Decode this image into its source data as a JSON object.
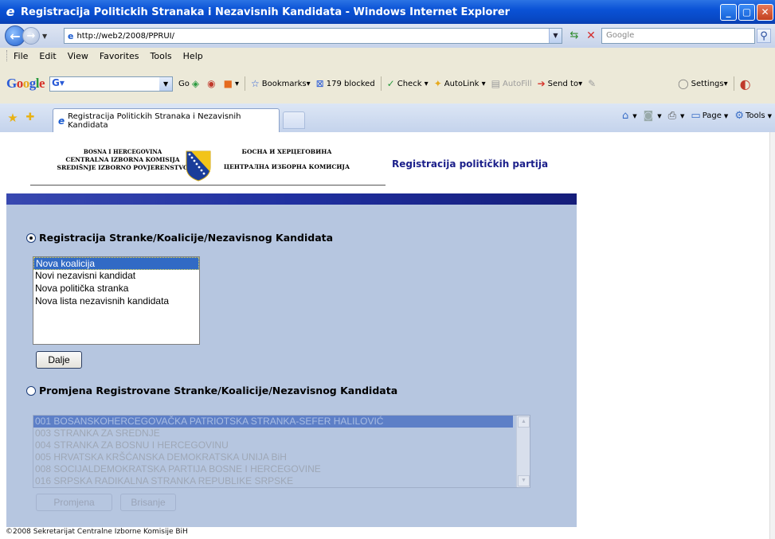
{
  "window": {
    "title": "Registracija Politickih Stranaka i Nezavisnih Kandidata - Windows Internet Explorer",
    "btn_min": "_",
    "btn_max": "▢",
    "btn_close": "✕"
  },
  "address": {
    "url": "http://web2/2008/PPRUI/",
    "search_placeholder": "Google"
  },
  "menu": [
    "File",
    "Edit",
    "View",
    "Favorites",
    "Tools",
    "Help"
  ],
  "google_toolbar": {
    "logo_letters": [
      "G",
      "o",
      "o",
      "g",
      "l",
      "e"
    ],
    "go_label": "Go",
    "bookmarks_label": "Bookmarks",
    "blocked_label": "179 blocked",
    "check_label": "Check",
    "autolink_label": "AutoLink",
    "autofill_label": "AutoFill",
    "sendto_label": "Send to",
    "settings_label": "Settings"
  },
  "tab": {
    "label": "Registracija Politickih Stranaka i Nezavisnih Kandidata"
  },
  "commandbar": {
    "page_label": "Page",
    "tools_label": "Tools"
  },
  "header": {
    "left_line1": "BOSNA I HERCEGOVINA",
    "left_line2": "CENTRALNA IZBORNA KOMISIJA",
    "left_line3": "SREDIŠNJE IZBORNO POVJERENSTVO",
    "right_line1": "БОСНА И ХЕРЦЕГОВИНА",
    "right_line2": "ЦЕНТРАЛНА ИЗБОРНА КОМИСИЈА",
    "page_title": "Registracija političkih partija"
  },
  "section1": {
    "heading": "Registracija Stranke/Koalicije/Nezavisnog Kandidata",
    "selected": true,
    "options": [
      "Nova koalicija",
      "Novi nezavisni kandidat",
      "Nova politička stranka",
      "Nova lista nezavisnih kandidata"
    ],
    "selected_option": "Nova koalicija",
    "next_button": "Dalje"
  },
  "section2": {
    "heading": "Promjena Registrovane Stranke/Koalicije/Nezavisnog Kandidata",
    "selected": false,
    "options": [
      "001 BOSANSKOHERCEGOVAČKA PATRIOTSKA STRANKA-SEFER HALILOVIĆ",
      "003 STRANKA ZA SREDNJE",
      "004 STRANKA ZA BOSNU I HERCEGOVINU",
      "005 HRVATSKA KRŠĆANSKA DEMOKRATSKA UNIJA BiH",
      "008 SOCIJALDEMOKRATSKA PARTIJA BOSNE I HERCEGOVINE",
      "016 SRPSKA RADIKALNA STRANKA REPUBLIKE SRPSKE"
    ],
    "change_button": "Promjena",
    "delete_button": "Brisanje"
  },
  "footer": "©2008 Sekretarijat Centralne Izborne Komisije BiH",
  "colors": {
    "panel": "#b6c6e0",
    "band": "#2030a0",
    "title": "#1b1f8a",
    "selection": "#316ac5"
  }
}
